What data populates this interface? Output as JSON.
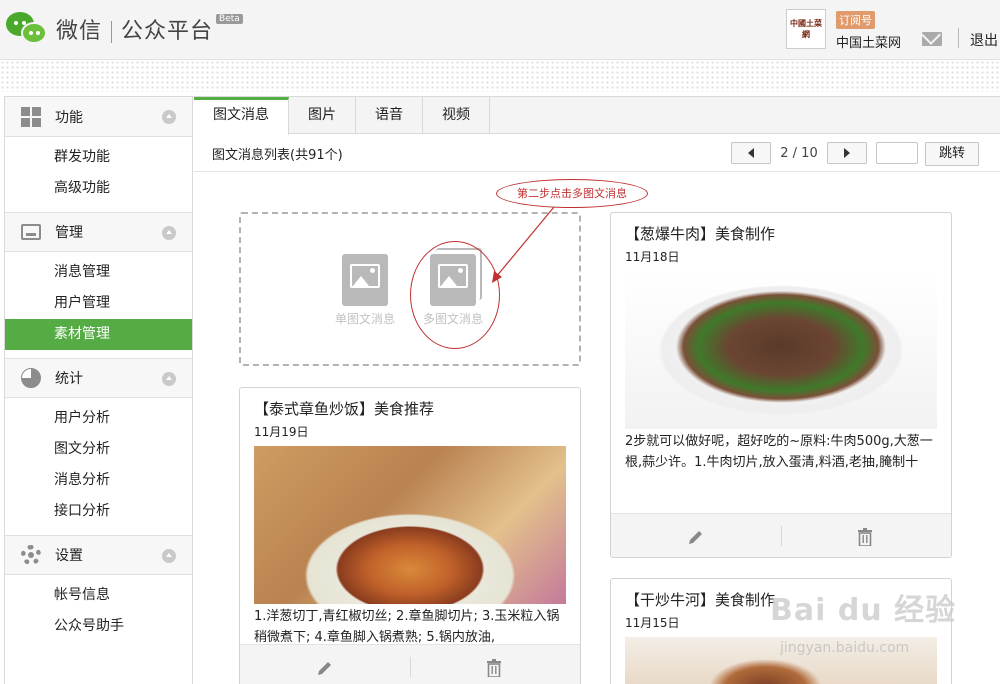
{
  "header": {
    "logo_text": "微信",
    "platform_text": "公众平台",
    "beta": "Beta",
    "account_type": "订阅号",
    "account_name": "中国土菜网",
    "avatar_text": "中國土菜網",
    "logout": "退出"
  },
  "sidebar": {
    "sections": [
      {
        "title": "功能",
        "icon": "grid-icon",
        "items": [
          "群发功能",
          "高级功能"
        ]
      },
      {
        "title": "管理",
        "icon": "inbox-icon",
        "items": [
          "消息管理",
          "用户管理",
          "素材管理"
        ]
      },
      {
        "title": "统计",
        "icon": "pie-chart-icon",
        "items": [
          "用户分析",
          "图文分析",
          "消息分析",
          "接口分析"
        ]
      },
      {
        "title": "设置",
        "icon": "gear-icon",
        "items": [
          "帐号信息",
          "公众号助手"
        ]
      }
    ],
    "active_item": "素材管理"
  },
  "tabs": [
    "图文消息",
    "图片",
    "语音",
    "视频"
  ],
  "toolbar": {
    "list_title": "图文消息列表(共91个)",
    "page_text": "2 / 10",
    "jump_label": "跳转"
  },
  "create": {
    "single_label": "单图文消息",
    "multi_label": "多图文消息",
    "annotation": "第二步点击多图文消息"
  },
  "cards": [
    {
      "title": "【泰式章鱼炒饭】美食推荐",
      "date": "11月19日",
      "desc": "1.洋葱切丁,青红椒切丝; 2.章鱼脚切片; 3.玉米粒入锅稍微煮下; 4.章鱼脚入锅煮熟; 5.锅内放油,"
    },
    {
      "title": "【葱爆牛肉】美食制作",
      "date": "11月18日",
      "desc": "2步就可以做好呢，超好吃的~原料:牛肉500g,大葱一根,蒜少许。1.牛肉切片,放入蛋清,料酒,老抽,腌制十"
    },
    {
      "title": "【干炒牛河】美食制作",
      "date": "11月15日"
    }
  ],
  "watermark": {
    "main": "Bai du 经验",
    "sub": "jingyan.baidu.com"
  },
  "colors": {
    "accent": "#56ac44",
    "annotation": "#c03030",
    "brand": "#4aa82b"
  }
}
